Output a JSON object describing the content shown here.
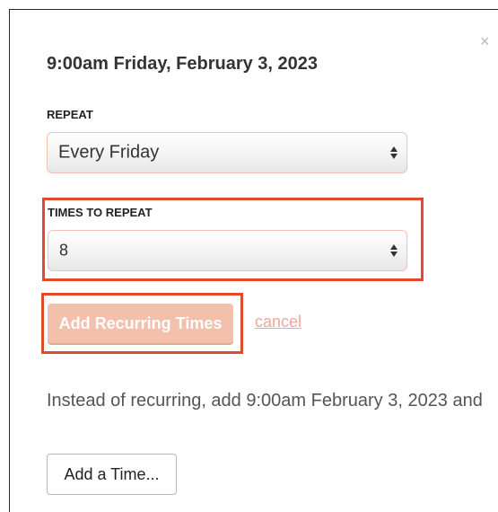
{
  "dialog": {
    "title": "9:00am Friday, February 3, 2023",
    "close_glyph": "×"
  },
  "repeat": {
    "label": "REPEAT",
    "selected": "Every Friday"
  },
  "times_to_repeat": {
    "label": "TIMES TO REPEAT",
    "selected": "8"
  },
  "actions": {
    "add_recurring_label": "Add Recurring Times",
    "cancel_label": "cancel"
  },
  "alternative": {
    "text": "Instead of recurring, add 9:00am February 3, 2023 and",
    "add_time_label": "Add a Time..."
  },
  "colors": {
    "highlight": "#e04a2d",
    "primary_button": "#f3c0ac",
    "link": "#f0a795"
  }
}
